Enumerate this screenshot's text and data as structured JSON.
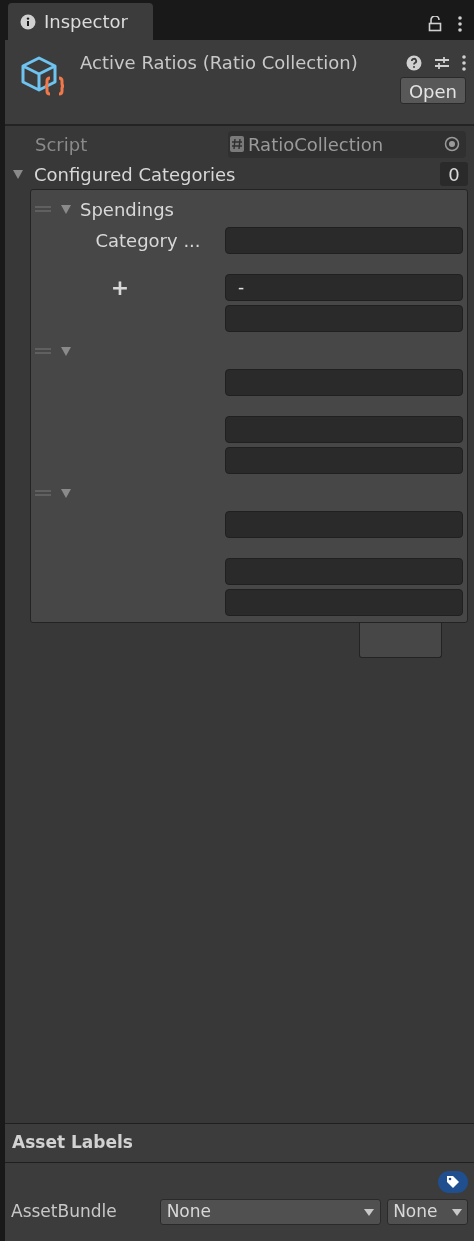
{
  "tab": {
    "title": "Inspector"
  },
  "header": {
    "title": "Active Ratios (Ratio Collection)",
    "open_button": "Open"
  },
  "script_row": {
    "label": "Script",
    "value": "RatioCollection"
  },
  "list": {
    "label": "Configured Categories",
    "expanded": true,
    "count": "0",
    "items": [
      {
        "label": "Spendings",
        "expanded": true,
        "groups": [
          {
            "label": "Category ...",
            "fields": [
              {
                "kind": "text"
              }
            ]
          },
          {
            "label": "+",
            "fields": [
              {
                "kind": "text",
                "value": "-"
              },
              {
                "kind": "text"
              }
            ]
          }
        ]
      },
      {
        "expanded": true,
        "groups": [
          {
            "fields": [
              {
                "kind": "text"
              }
            ]
          },
          {
            "fields": [
              {
                "kind": "text"
              },
              {
                "kind": "text"
              }
            ]
          }
        ]
      },
      {
        "expanded": true,
        "groups": [
          {
            "fields": [
              {
                "kind": "text"
              }
            ]
          },
          {
            "fields": [
              {
                "kind": "text"
              },
              {
                "kind": "text"
              }
            ]
          }
        ]
      }
    ]
  },
  "asset_labels": {
    "title": "Asset Labels",
    "bundle_label": "AssetBundle",
    "bundle": "None",
    "variant": "None"
  }
}
